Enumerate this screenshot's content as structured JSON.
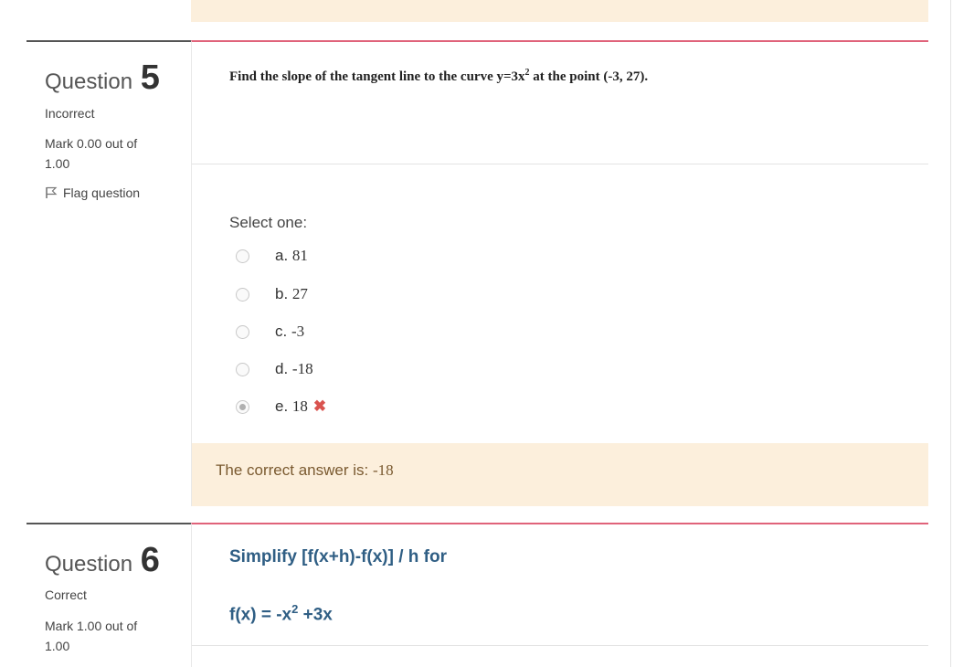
{
  "question5": {
    "label": "Question",
    "number": "5",
    "state": "Incorrect",
    "grade_line1": "Mark 0.00 out of",
    "grade_line2": "1.00",
    "flag_label": "Flag question",
    "text_prefix": "Find the slope of the tangent line to the curve y=3x",
    "text_sup": "2",
    "text_suffix": " at the point (-3, 27).",
    "select_prompt": "Select one:",
    "answers": [
      {
        "letter": "a. ",
        "value": "81",
        "checked": false
      },
      {
        "letter": "b. ",
        "value": "27",
        "checked": false
      },
      {
        "letter": "c. ",
        "value": "-3",
        "checked": false
      },
      {
        "letter": "d. ",
        "value": "-18",
        "checked": false
      },
      {
        "letter": "e. ",
        "value": "18",
        "checked": true,
        "mark": "✖"
      }
    ],
    "feedback_prefix": "The correct answer is: ",
    "feedback_value": "-18"
  },
  "question6": {
    "label": "Question",
    "number": "6",
    "state": "Correct",
    "grade_line1": "Mark 1.00 out of",
    "grade_line2": "1.00",
    "text_line1": "Simplify [f(x+h)-f(x)] / h for",
    "text_line2_prefix": "f(x) = -x",
    "text_line2_sup": "2",
    "text_line2_suffix": " +3x"
  },
  "colors": {
    "accent_line": "#e0637a",
    "feedback_bg": "#fcefdc",
    "incorrect_mark": "#d9534f",
    "question_text_blue": "#2f5e84"
  }
}
